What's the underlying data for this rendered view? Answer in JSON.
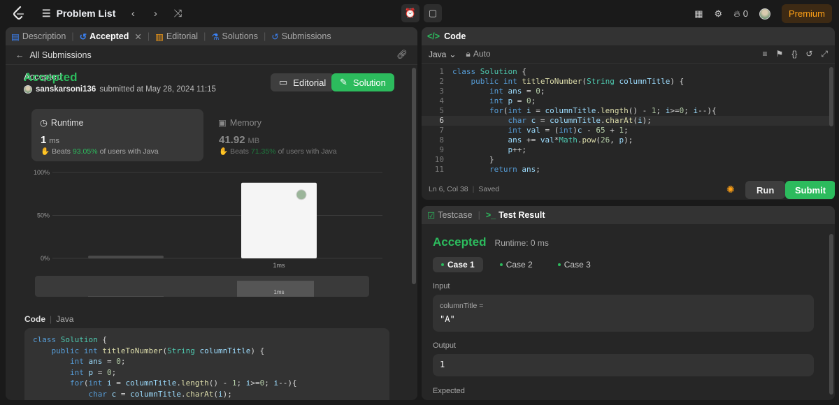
{
  "topbar": {
    "problem_list": "Problem List",
    "streak_count": "0",
    "premium": "Premium"
  },
  "left": {
    "tabs": {
      "description": "Description",
      "accepted": "Accepted",
      "editorial": "Editorial",
      "solutions": "Solutions",
      "submissions": "Submissions"
    },
    "all_submissions": "All Submissions",
    "status": "Accepted",
    "user": "sanskarsoni136",
    "submitted_text": "submitted at May 28, 2024 11:15",
    "editorial_btn": "Editorial",
    "solution_btn": "Solution",
    "runtime": {
      "label": "Runtime",
      "value": "1",
      "unit": "ms",
      "beats_prefix": "Beats",
      "beats_pct": "93.05%",
      "beats_suffix": "of users with Java"
    },
    "memory": {
      "label": "Memory",
      "value": "41.92",
      "unit": "MB",
      "beats_prefix": "Beats",
      "beats_pct": "71.35%",
      "beats_suffix": "of users with Java"
    },
    "code_label": "Code",
    "code_lang": "Java"
  },
  "chart_data": {
    "type": "bar",
    "categories": [
      "",
      "1ms"
    ],
    "values": [
      3,
      88
    ],
    "yticks": [
      "100%",
      "50%",
      "0%"
    ],
    "ylim": [
      0,
      100
    ],
    "xlabel": "1ms",
    "minimap_label": "1ms",
    "minimap_values": [
      3,
      88
    ]
  },
  "left_code": [
    "class Solution {",
    "    public int titleToNumber(String columnTitle) {",
    "        int ans = 0;",
    "        int p = 0;",
    "        for(int i = columnTitle.length() - 1; i>=0; i--){",
    "            char c = columnTitle.charAt(i);"
  ],
  "editor": {
    "title": "Code",
    "lang": "Java",
    "auto": "Auto",
    "status_pos": "Ln 6, Col 38",
    "status_saved": "Saved",
    "run": "Run",
    "submit": "Submit",
    "line_numbers": [
      "1",
      "2",
      "3",
      "4",
      "5",
      "6",
      "7",
      "8",
      "9",
      "10",
      "11"
    ],
    "lines": [
      "class Solution {",
      "    public int titleToNumber(String columnTitle) {",
      "        int ans = 0;",
      "        int p = 0;",
      "        for(int i = columnTitle.length() - 1; i>=0; i--){",
      "            char c = columnTitle.charAt(i);",
      "            int val = (int)c - 65 + 1;",
      "            ans += val*Math.pow(26, p);",
      "            p++;",
      "        }",
      "        return ans;"
    ]
  },
  "result": {
    "testcase_tab": "Testcase",
    "result_tab": "Test Result",
    "status": "Accepted",
    "runtime": "Runtime: 0 ms",
    "cases": [
      "Case 1",
      "Case 2",
      "Case 3"
    ],
    "input_label": "Input",
    "param_name": "columnTitle =",
    "param_value": "\"A\"",
    "output_label": "Output",
    "output_value": "1",
    "expected_label": "Expected"
  }
}
